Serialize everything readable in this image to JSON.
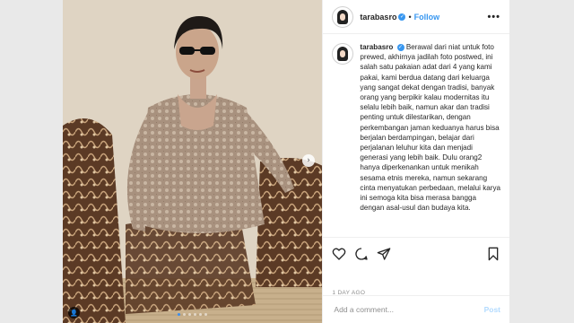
{
  "post": {
    "username": "tarabasro",
    "separator": "•",
    "follow_label": "Follow",
    "more_label": "•••",
    "verified_mark": "✓",
    "caption": "Berawal dari niat untuk foto prewed, akhirnya jadilah foto postwed, ini salah satu pakaian adat dari 4 yang kami pakai, kami berdua datang dari keluarga yang sangat dekat dengan tradisi, banyak orang yang berpikir kalau modernitas itu selalu lebih baik, namun akar dan tradisi penting untuk dilestarikan, dengan perkembangan jaman keduanya harus bisa berjalan berdampingan, belajar dari perjalanan leluhur kita dan menjadi generasi yang lebih baik. Dulu orang2 hanya diperkenankan untuk menikah sesama etnis mereka, namun sekarang cinta menyatukan perbedaan, melalui karya ini semoga kita bisa merasa bangga dengan asal-usul dan budaya kita.",
    "timestamp": "1 DAY AGO",
    "comment_placeholder": "Add a comment...",
    "post_label": "Post",
    "carousel_arrow": "›",
    "tag_icon": "👤",
    "carousel_slides": 6,
    "carousel_active": 1
  },
  "icons": [
    "heart-icon",
    "comment-icon",
    "share-icon",
    "bookmark-icon",
    "user-tag-icon",
    "chevron-right-icon",
    "verified-icon"
  ],
  "colors": {
    "accent": "#3897f0",
    "post_disabled": "#b3dbff",
    "muted": "#8e8e8e",
    "text": "#262626",
    "background": "#e9e9e9"
  }
}
